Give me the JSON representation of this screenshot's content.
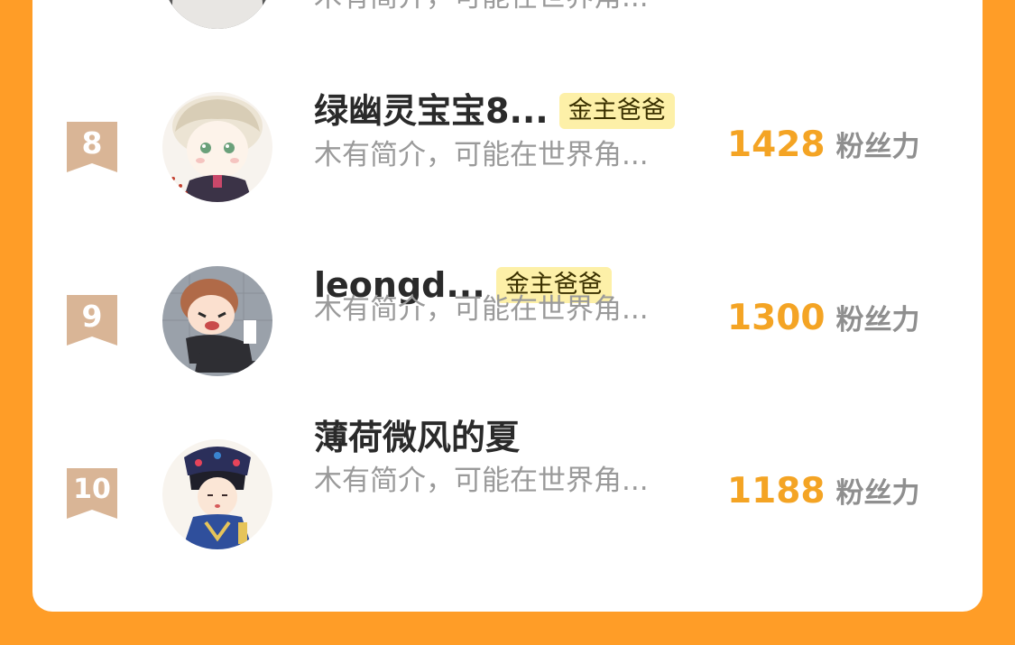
{
  "ranking": {
    "partial_top_row": {
      "intro": "木有简介，可能在世界角..."
    },
    "rows": [
      {
        "rank": "8",
        "name": "绿幽灵宝宝8...",
        "tag": "金主爸爸",
        "intro": "木有简介，可能在世界角...",
        "score": "1428",
        "score_unit": "粉丝力"
      },
      {
        "rank": "9",
        "name": "leongd...",
        "tag": "金主爸爸",
        "intro": "木有简介，可能在世界角...",
        "score": "1300",
        "score_unit": "粉丝力"
      },
      {
        "rank": "10",
        "name": "薄荷微风的夏",
        "intro": "木有简介，可能在世界角...",
        "score": "1188",
        "score_unit": "粉丝力"
      }
    ]
  },
  "colors": {
    "page_background": "#ff9d27",
    "card_background": "#ffffff",
    "score": "#f4a424",
    "tag_background": "#fdf0a8",
    "rank_badge": "#d9b596"
  }
}
